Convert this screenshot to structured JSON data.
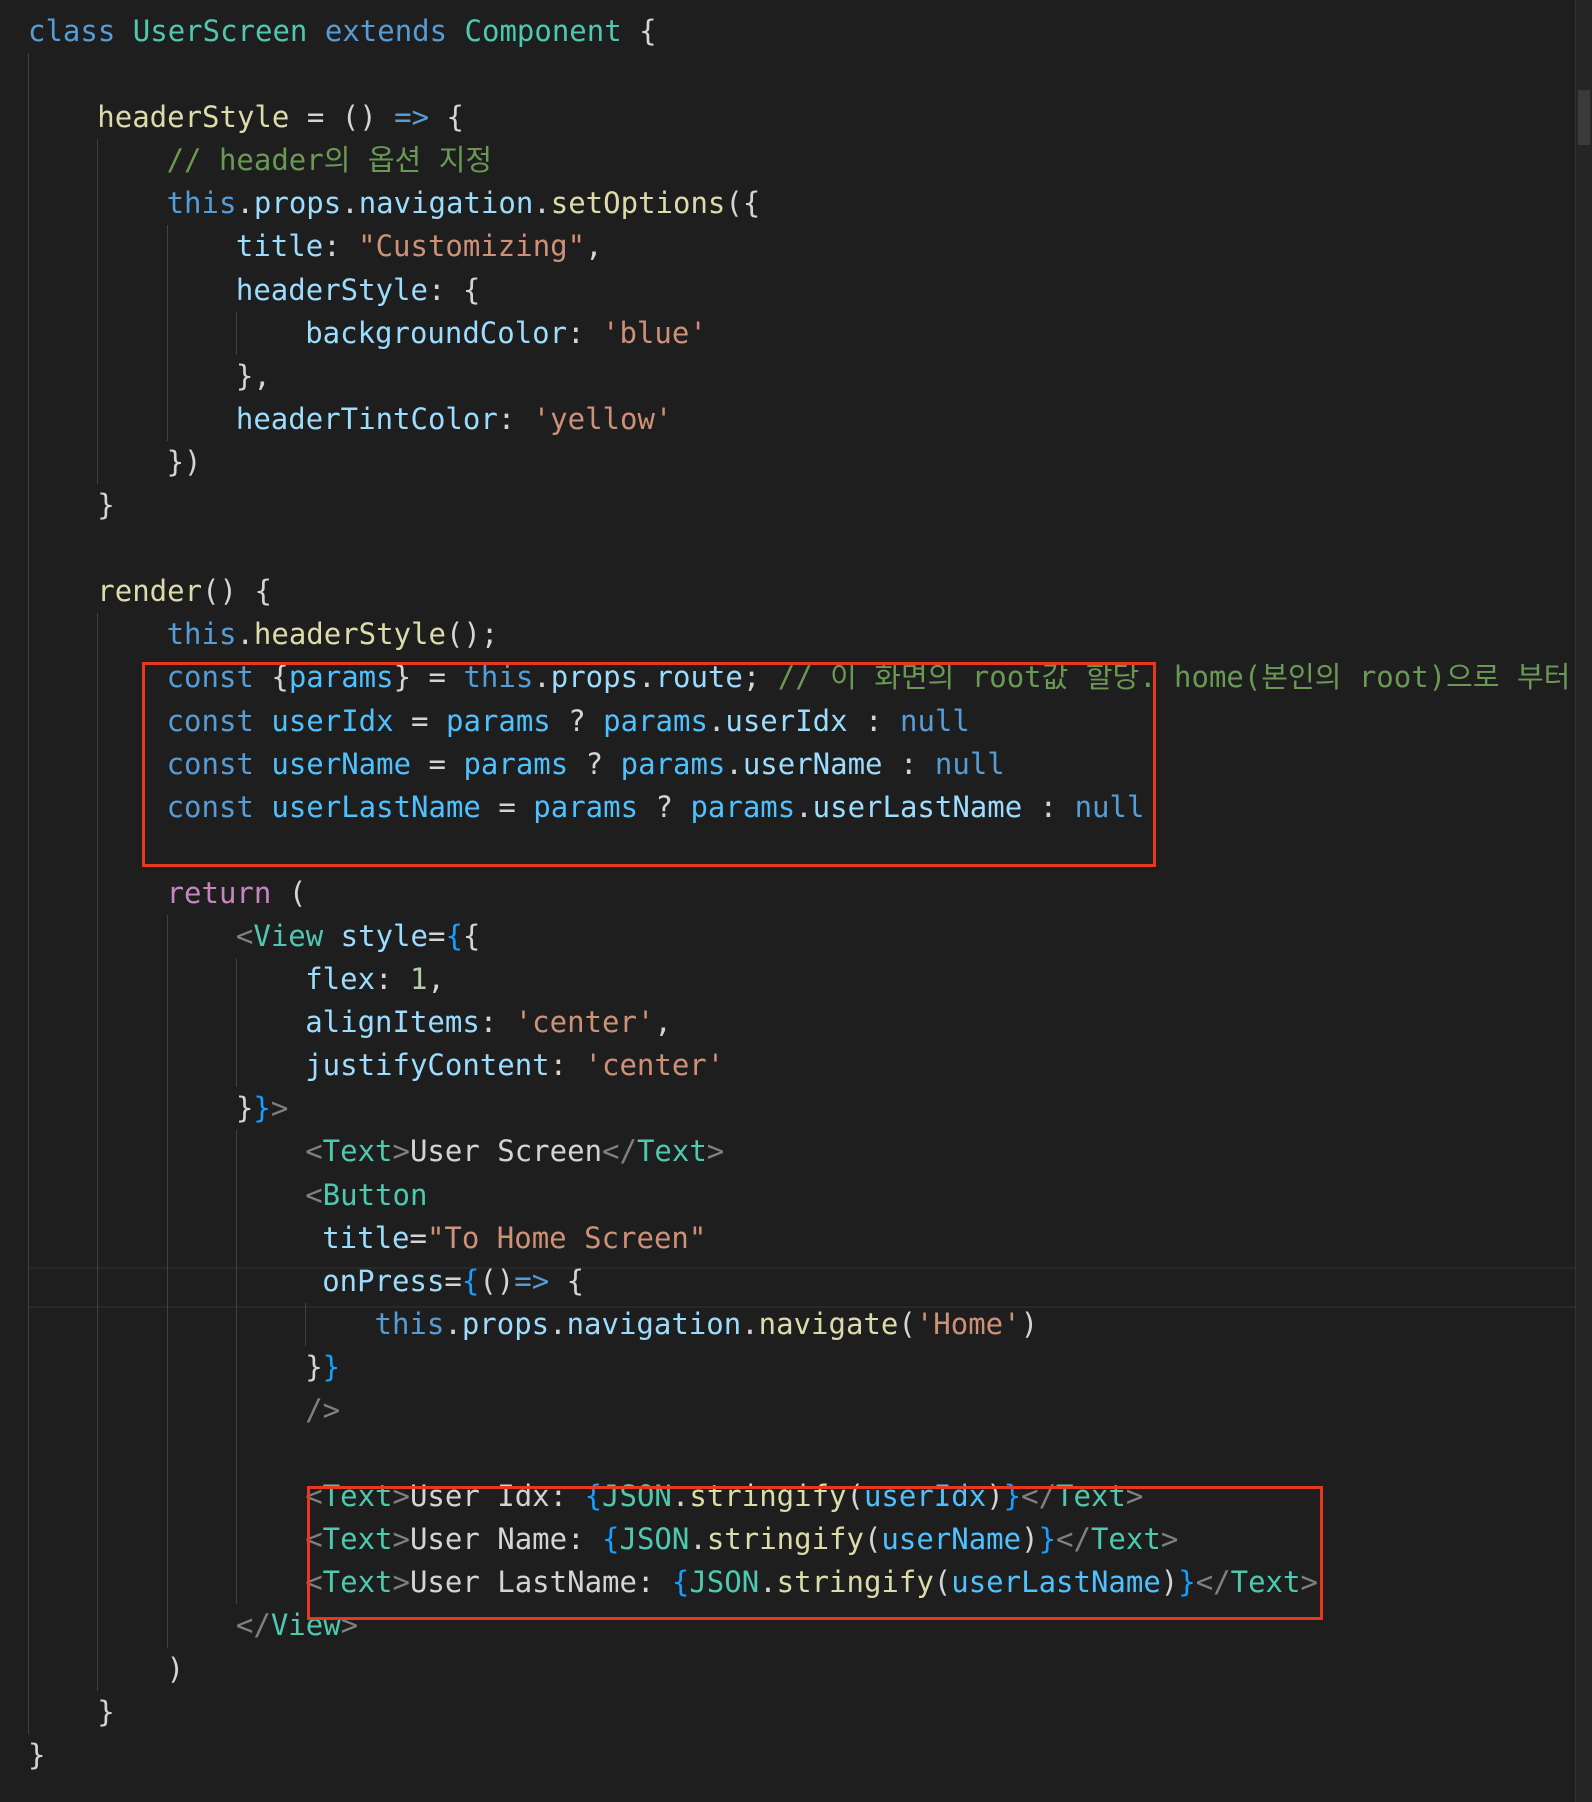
{
  "editor": {
    "language": "javascript-react",
    "lines": [
      {
        "indent": 0,
        "tokens": [
          [
            "kw",
            "class"
          ],
          [
            "txt",
            " "
          ],
          [
            "cls",
            "UserScreen"
          ],
          [
            "txt",
            " "
          ],
          [
            "kw",
            "extends"
          ],
          [
            "txt",
            " "
          ],
          [
            "cls",
            "Component"
          ],
          [
            "txt",
            " {"
          ]
        ]
      },
      {
        "indent": 1,
        "tokens": []
      },
      {
        "indent": 1,
        "tokens": [
          [
            "fn",
            "headerStyle"
          ],
          [
            "txt",
            " = () "
          ],
          [
            "kw",
            "=>"
          ],
          [
            "txt",
            " {"
          ]
        ]
      },
      {
        "indent": 2,
        "tokens": [
          [
            "cmt",
            "// header의 옵션 지정"
          ]
        ]
      },
      {
        "indent": 2,
        "tokens": [
          [
            "kw",
            "this"
          ],
          [
            "txt",
            "."
          ],
          [
            "prop",
            "props"
          ],
          [
            "txt",
            "."
          ],
          [
            "prop",
            "navigation"
          ],
          [
            "txt",
            "."
          ],
          [
            "fn",
            "setOptions"
          ],
          [
            "txt",
            "({"
          ]
        ]
      },
      {
        "indent": 3,
        "tokens": [
          [
            "prop",
            "title"
          ],
          [
            "txt",
            ": "
          ],
          [
            "str",
            "\"Customizing\""
          ],
          [
            "txt",
            ","
          ]
        ]
      },
      {
        "indent": 3,
        "tokens": [
          [
            "prop",
            "headerStyle"
          ],
          [
            "txt",
            ": {"
          ]
        ]
      },
      {
        "indent": 4,
        "tokens": [
          [
            "prop",
            "backgroundColor"
          ],
          [
            "txt",
            ": "
          ],
          [
            "str",
            "'blue'"
          ]
        ]
      },
      {
        "indent": 3,
        "tokens": [
          [
            "txt",
            "},"
          ]
        ]
      },
      {
        "indent": 3,
        "tokens": [
          [
            "prop",
            "headerTintColor"
          ],
          [
            "txt",
            ": "
          ],
          [
            "str",
            "'yellow'"
          ]
        ]
      },
      {
        "indent": 2,
        "tokens": [
          [
            "txt",
            "})"
          ]
        ]
      },
      {
        "indent": 1,
        "tokens": [
          [
            "txt",
            "}"
          ]
        ]
      },
      {
        "indent": 1,
        "tokens": []
      },
      {
        "indent": 1,
        "tokens": [
          [
            "fn",
            "render"
          ],
          [
            "txt",
            "() {"
          ]
        ]
      },
      {
        "indent": 2,
        "tokens": [
          [
            "kw",
            "this"
          ],
          [
            "txt",
            "."
          ],
          [
            "fn",
            "headerStyle"
          ],
          [
            "txt",
            "();"
          ]
        ]
      },
      {
        "indent": 2,
        "tokens": [
          [
            "kw",
            "const"
          ],
          [
            "txt",
            " {"
          ],
          [
            "var",
            "params"
          ],
          [
            "txt",
            "} = "
          ],
          [
            "kw",
            "this"
          ],
          [
            "txt",
            "."
          ],
          [
            "prop",
            "props"
          ],
          [
            "txt",
            "."
          ],
          [
            "prop",
            "route"
          ],
          [
            "txt",
            "; "
          ],
          [
            "cmt",
            "// 이 화면의 root값 할당. home(본인의 root)으로 부터 넘"
          ]
        ]
      },
      {
        "indent": 2,
        "tokens": [
          [
            "kw",
            "const"
          ],
          [
            "txt",
            " "
          ],
          [
            "var",
            "userIdx"
          ],
          [
            "txt",
            " = "
          ],
          [
            "var",
            "params"
          ],
          [
            "txt",
            " ? "
          ],
          [
            "var",
            "params"
          ],
          [
            "txt",
            "."
          ],
          [
            "prop",
            "userIdx"
          ],
          [
            "txt",
            " : "
          ],
          [
            "kw",
            "null"
          ]
        ]
      },
      {
        "indent": 2,
        "tokens": [
          [
            "kw",
            "const"
          ],
          [
            "txt",
            " "
          ],
          [
            "var",
            "userName"
          ],
          [
            "txt",
            " = "
          ],
          [
            "var",
            "params"
          ],
          [
            "txt",
            " ? "
          ],
          [
            "var",
            "params"
          ],
          [
            "txt",
            "."
          ],
          [
            "prop",
            "userName"
          ],
          [
            "txt",
            " : "
          ],
          [
            "kw",
            "null"
          ]
        ]
      },
      {
        "indent": 2,
        "tokens": [
          [
            "kw",
            "const"
          ],
          [
            "txt",
            " "
          ],
          [
            "var",
            "userLastName"
          ],
          [
            "txt",
            " = "
          ],
          [
            "var",
            "params"
          ],
          [
            "txt",
            " ? "
          ],
          [
            "var",
            "params"
          ],
          [
            "txt",
            "."
          ],
          [
            "prop",
            "userLastName"
          ],
          [
            "txt",
            " : "
          ],
          [
            "kw",
            "null"
          ]
        ]
      },
      {
        "indent": 2,
        "tokens": []
      },
      {
        "indent": 2,
        "tokens": [
          [
            "ctl",
            "return"
          ],
          [
            "txt",
            " ("
          ]
        ]
      },
      {
        "indent": 3,
        "tokens": [
          [
            "tag",
            "<"
          ],
          [
            "cls",
            "View"
          ],
          [
            "txt",
            " "
          ],
          [
            "prop",
            "style"
          ],
          [
            "txt",
            "="
          ],
          [
            "brb",
            "{"
          ],
          [
            "txt",
            "{"
          ]
        ]
      },
      {
        "indent": 4,
        "tokens": [
          [
            "prop",
            "flex"
          ],
          [
            "txt",
            ": "
          ],
          [
            "num",
            "1"
          ],
          [
            "txt",
            ","
          ]
        ]
      },
      {
        "indent": 4,
        "tokens": [
          [
            "prop",
            "alignItems"
          ],
          [
            "txt",
            ": "
          ],
          [
            "str",
            "'center'"
          ],
          [
            "txt",
            ","
          ]
        ]
      },
      {
        "indent": 4,
        "tokens": [
          [
            "prop",
            "justifyContent"
          ],
          [
            "txt",
            ": "
          ],
          [
            "str",
            "'center'"
          ]
        ]
      },
      {
        "indent": 3,
        "tokens": [
          [
            "txt",
            "}"
          ],
          [
            "brb",
            "}"
          ],
          [
            "tag",
            ">"
          ]
        ]
      },
      {
        "indent": 4,
        "tokens": [
          [
            "tag",
            "<"
          ],
          [
            "cls",
            "Text"
          ],
          [
            "tag",
            ">"
          ],
          [
            "txt",
            "User Screen"
          ],
          [
            "tag",
            "</"
          ],
          [
            "cls",
            "Text"
          ],
          [
            "tag",
            ">"
          ]
        ]
      },
      {
        "indent": 4,
        "tokens": [
          [
            "tag",
            "<"
          ],
          [
            "cls",
            "Button"
          ]
        ]
      },
      {
        "indent": 4,
        "pad": 1,
        "tokens": [
          [
            "prop",
            "title"
          ],
          [
            "txt",
            "="
          ],
          [
            "str",
            "\"To Home Screen\""
          ]
        ]
      },
      {
        "indent": 4,
        "pad": 1,
        "tokens": [
          [
            "prop",
            "onPress"
          ],
          [
            "txt",
            "="
          ],
          [
            "brb",
            "{"
          ],
          [
            "txt",
            "()"
          ],
          [
            "kw",
            "=>"
          ],
          [
            "txt",
            " {"
          ]
        ]
      },
      {
        "indent": 5,
        "tokens": [
          [
            "kw",
            "this"
          ],
          [
            "txt",
            "."
          ],
          [
            "prop",
            "props"
          ],
          [
            "txt",
            "."
          ],
          [
            "prop",
            "navigation"
          ],
          [
            "txt",
            "."
          ],
          [
            "fn",
            "navigate"
          ],
          [
            "txt",
            "("
          ],
          [
            "str",
            "'Home'"
          ],
          [
            "txt",
            ")"
          ]
        ]
      },
      {
        "indent": 4,
        "tokens": [
          [
            "txt",
            "}"
          ],
          [
            "brb",
            "}"
          ]
        ]
      },
      {
        "indent": 4,
        "tokens": [
          [
            "tag",
            "/>"
          ]
        ]
      },
      {
        "indent": 4,
        "tokens": []
      },
      {
        "indent": 4,
        "tokens": [
          [
            "tag",
            "<"
          ],
          [
            "cls",
            "Text"
          ],
          [
            "tag",
            ">"
          ],
          [
            "txt",
            "User Idx: "
          ],
          [
            "brb",
            "{"
          ],
          [
            "cls",
            "JSON"
          ],
          [
            "txt",
            "."
          ],
          [
            "fn",
            "stringify"
          ],
          [
            "txt",
            "("
          ],
          [
            "var",
            "userIdx"
          ],
          [
            "txt",
            ")"
          ],
          [
            "brb",
            "}"
          ],
          [
            "tag",
            "</"
          ],
          [
            "cls",
            "Text"
          ],
          [
            "tag",
            ">"
          ]
        ]
      },
      {
        "indent": 4,
        "tokens": [
          [
            "tag",
            "<"
          ],
          [
            "cls",
            "Text"
          ],
          [
            "tag",
            ">"
          ],
          [
            "txt",
            "User Name: "
          ],
          [
            "brb",
            "{"
          ],
          [
            "cls",
            "JSON"
          ],
          [
            "txt",
            "."
          ],
          [
            "fn",
            "stringify"
          ],
          [
            "txt",
            "("
          ],
          [
            "var",
            "userName"
          ],
          [
            "txt",
            ")"
          ],
          [
            "brb",
            "}"
          ],
          [
            "tag",
            "</"
          ],
          [
            "cls",
            "Text"
          ],
          [
            "tag",
            ">"
          ]
        ]
      },
      {
        "indent": 4,
        "tokens": [
          [
            "tag",
            "<"
          ],
          [
            "cls",
            "Text"
          ],
          [
            "tag",
            ">"
          ],
          [
            "txt",
            "User LastName: "
          ],
          [
            "brb",
            "{"
          ],
          [
            "cls",
            "JSON"
          ],
          [
            "txt",
            "."
          ],
          [
            "fn",
            "stringify"
          ],
          [
            "txt",
            "("
          ],
          [
            "var",
            "userLastName"
          ],
          [
            "txt",
            ")"
          ],
          [
            "brb",
            "}"
          ],
          [
            "tag",
            "</"
          ],
          [
            "cls",
            "Text"
          ],
          [
            "tag",
            ">"
          ]
        ]
      },
      {
        "indent": 3,
        "tokens": [
          [
            "tag",
            "</"
          ],
          [
            "cls",
            "View"
          ],
          [
            "tag",
            ">"
          ]
        ]
      },
      {
        "indent": 2,
        "tokens": [
          [
            "txt",
            ")"
          ]
        ]
      },
      {
        "indent": 1,
        "tokens": [
          [
            "txt",
            "}"
          ]
        ]
      },
      {
        "indent": 0,
        "tokens": [
          [
            "txt",
            "}"
          ]
        ]
      }
    ]
  }
}
